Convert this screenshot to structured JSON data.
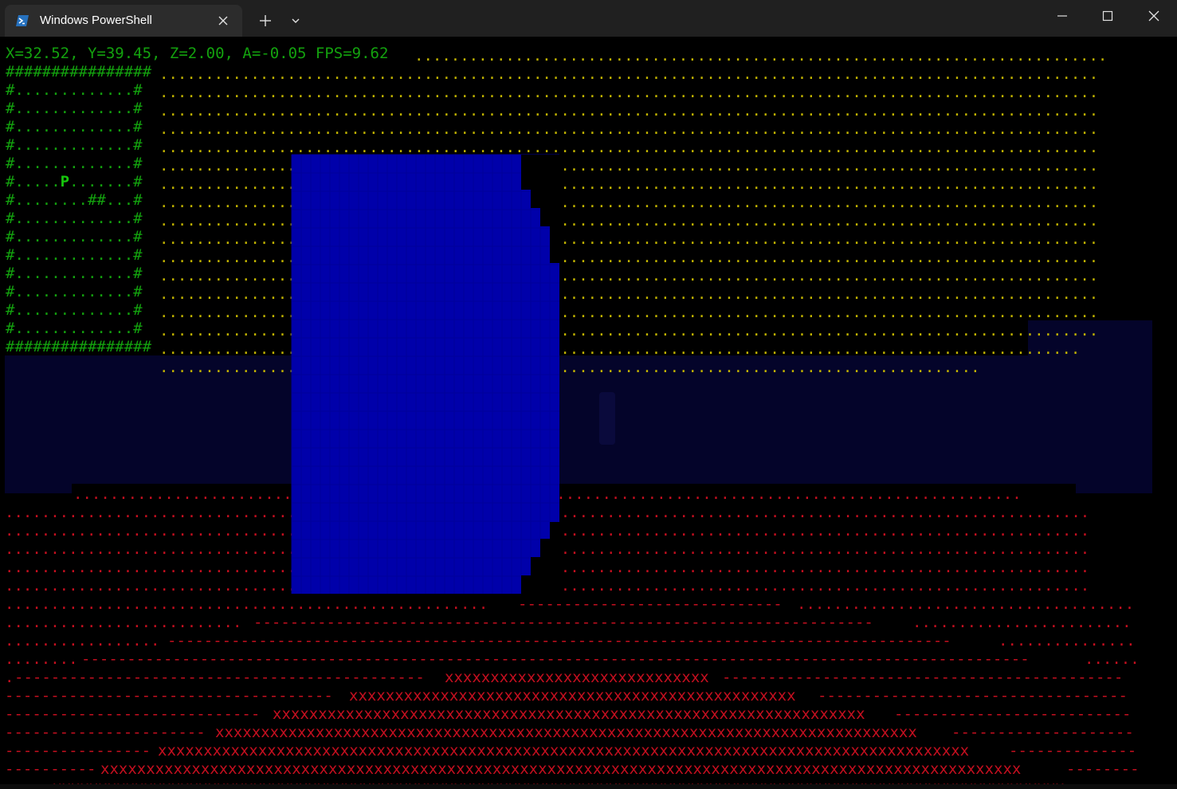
{
  "window": {
    "tab_title": "Windows PowerShell",
    "tab_icon": "powershell-icon",
    "new_tab_icon": "plus-icon",
    "dropdown_icon": "chevron-down-icon",
    "controls": [
      "minimize-icon",
      "maximize-icon",
      "close-icon"
    ]
  },
  "terminal": {
    "status_line": "X=32.52, Y=39.45, Z=2.00, A=-0.05 FPS=9.62",
    "minimap": {
      "top_border": "################",
      "rows": [
        "#.............#",
        "#.............#",
        "#.............#",
        "#.............#",
        "#.............#",
        "#.....P.......#",
        "#........##...#",
        "#.............#",
        "#.............#",
        "#.............#",
        "#.............#",
        "#.............#",
        "#.............#",
        "#.............#"
      ],
      "bottom_border": "################",
      "player_char": "P"
    },
    "glyphs": {
      "sky": ".",
      "floor_far": ".",
      "floor_mid": "-",
      "floor_near": "x"
    },
    "colors": {
      "background": "#000000",
      "status_text": "#13a10e",
      "sky_dots": "#c1b300",
      "floor": "#c50f1f",
      "wall": "#0000aa",
      "horizon_band": "#04042a"
    }
  }
}
